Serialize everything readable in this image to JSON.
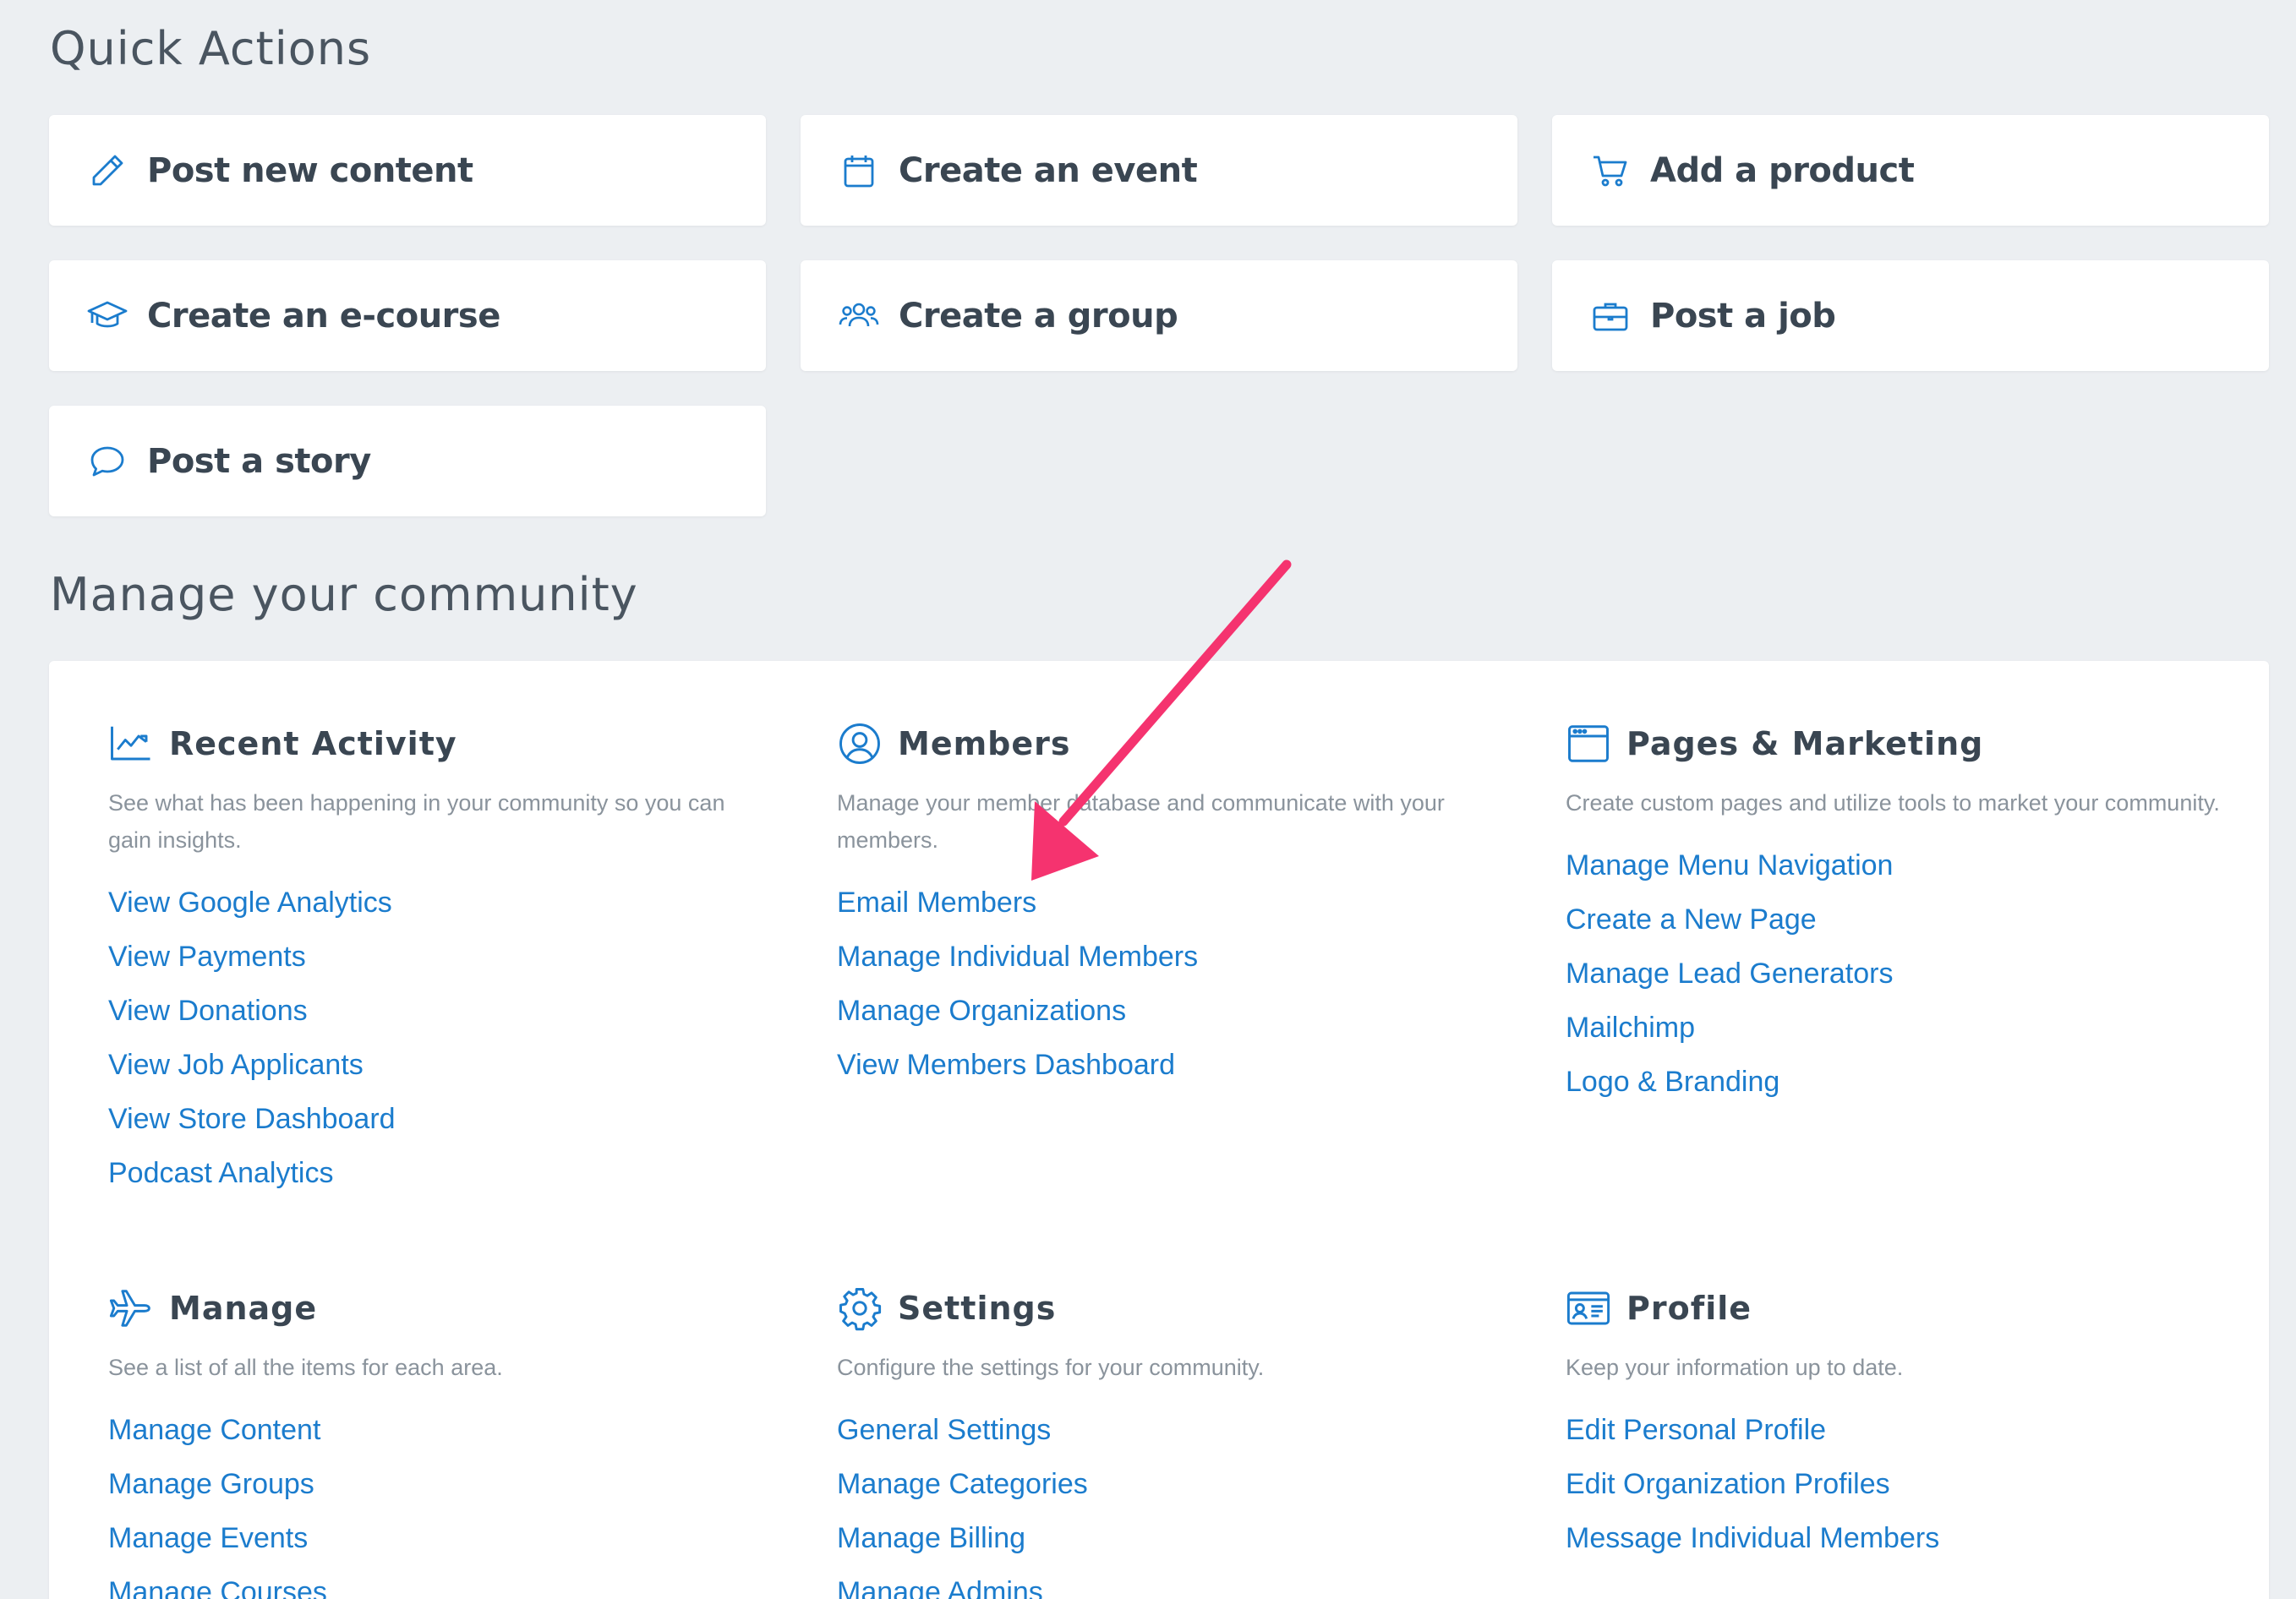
{
  "quick_actions": {
    "title": "Quick Actions",
    "items": [
      {
        "label": "Post new content",
        "icon": "pencil-icon"
      },
      {
        "label": "Create an event",
        "icon": "calendar-icon"
      },
      {
        "label": "Add a product",
        "icon": "cart-icon"
      },
      {
        "label": "Create an e-course",
        "icon": "graduation-cap-icon"
      },
      {
        "label": "Create a group",
        "icon": "group-icon"
      },
      {
        "label": "Post a job",
        "icon": "briefcase-icon"
      },
      {
        "label": "Post a story",
        "icon": "speech-bubble-icon"
      }
    ]
  },
  "manage": {
    "title": "Manage your community",
    "sections": [
      {
        "title": "Recent Activity",
        "icon": "chart-line-icon",
        "description": "See what has been happening in your community so you can gain insights.",
        "links": [
          "View Google Analytics",
          "View Payments",
          "View Donations",
          "View Job Applicants",
          "View Store Dashboard",
          "Podcast Analytics"
        ]
      },
      {
        "title": "Members",
        "icon": "user-circle-icon",
        "description": "Manage your member database and communicate with your members.",
        "links": [
          "Email Members",
          "Manage Individual Members",
          "Manage Organizations",
          "View Members Dashboard"
        ]
      },
      {
        "title": "Pages & Marketing",
        "icon": "browser-window-icon",
        "description": "Create custom pages and utilize tools to market your community.",
        "links": [
          "Manage Menu Navigation",
          "Create a New Page",
          "Manage Lead Generators",
          "Mailchimp",
          "Logo & Branding"
        ]
      },
      {
        "title": "Manage",
        "icon": "airplane-icon",
        "description": "See a list of all the items for each area.",
        "links": [
          "Manage Content",
          "Manage Groups",
          "Manage Events",
          "Manage Courses"
        ]
      },
      {
        "title": "Settings",
        "icon": "gear-icon",
        "description": "Configure the settings for your community.",
        "links": [
          "General Settings",
          "Manage Categories",
          "Manage Billing",
          "Manage Admins"
        ]
      },
      {
        "title": "Profile",
        "icon": "id-card-icon",
        "description": "Keep your information up to date.",
        "links": [
          "Edit Personal Profile",
          "Edit Organization Profiles",
          "Message Individual Members"
        ]
      }
    ]
  },
  "colors": {
    "background": "#eceff2",
    "card": "#ffffff",
    "heading": "#3a4652",
    "link": "#1b7ccd",
    "muted": "#8a939c",
    "annotation_arrow": "#f5336f"
  }
}
